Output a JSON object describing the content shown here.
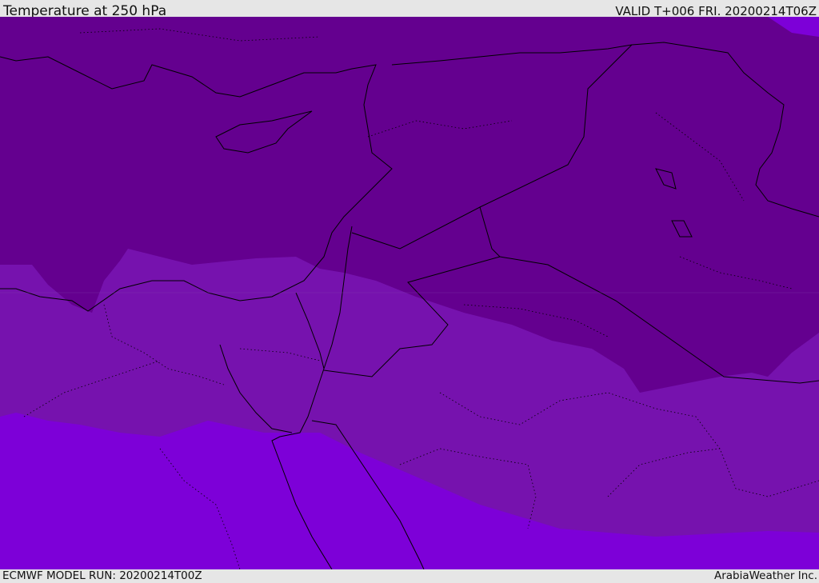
{
  "header": {
    "title": "Temperature at 250 hPa",
    "valid": "VALID T+006 FRI. 20200214T06Z"
  },
  "footer": {
    "model_run": "ECMWF MODEL RUN: 20200214T00Z",
    "credit": "ArabiaWeather Inc."
  },
  "map": {
    "region": "Eastern Mediterranean / Middle East",
    "colors": {
      "cold_band": "#64008f",
      "mid_band": "#7612ae",
      "warm_band": "#7d00d8",
      "coast": "#000000",
      "header_bg": "#e6e6e6"
    }
  }
}
